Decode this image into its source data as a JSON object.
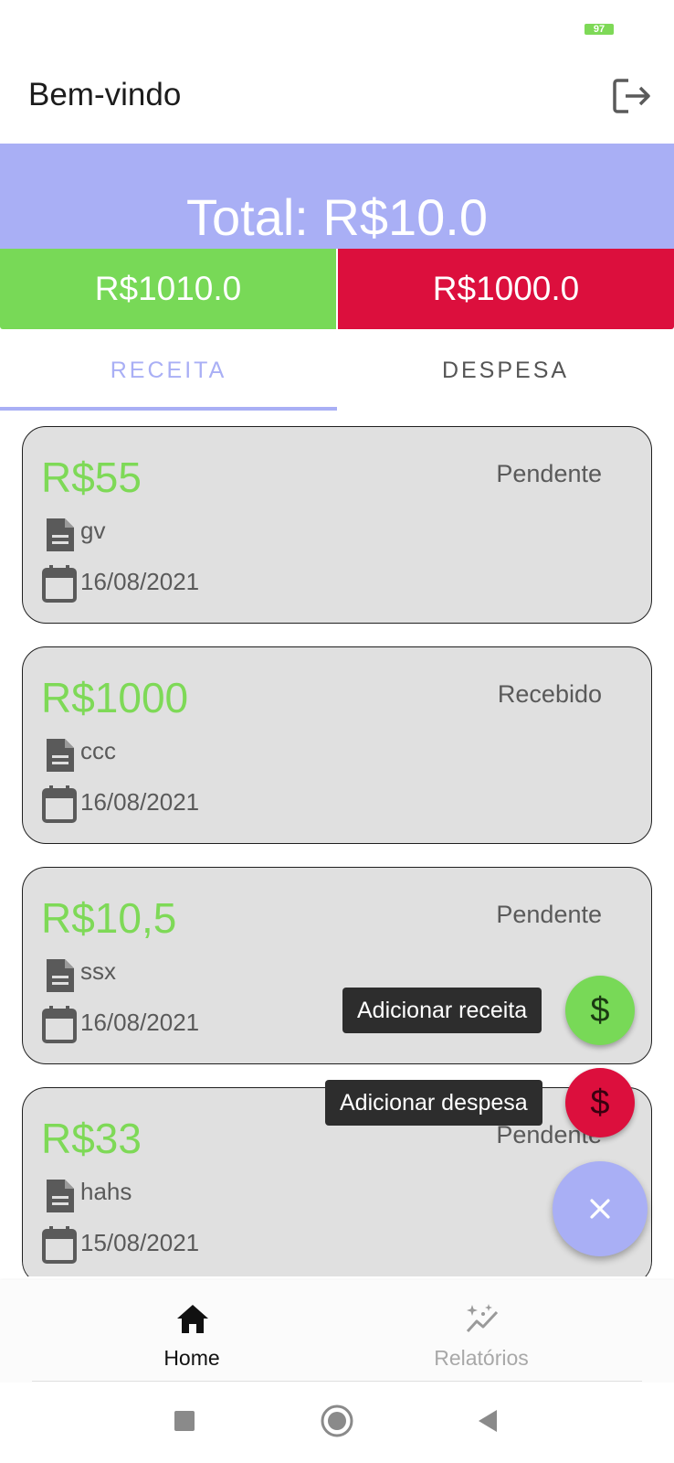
{
  "status_bar": {
    "battery": "97"
  },
  "app_bar": {
    "title": "Bem-vindo",
    "logout_icon": "logout-icon"
  },
  "summary": {
    "total": "Total: R$10.0",
    "income": "R$1010.0",
    "expense": "R$1000.0",
    "colors": {
      "total_bg": "#a9aff5",
      "income_bg": "#78d957",
      "expense_bg": "#dc0f3d"
    }
  },
  "tabs": [
    {
      "label": "RECEITA",
      "active": true
    },
    {
      "label": "DESPESA",
      "active": false
    }
  ],
  "entries": [
    {
      "amount": "R$55",
      "status": "Pendente",
      "description": "gv",
      "date": "16/08/2021"
    },
    {
      "amount": "R$1000",
      "status": "Recebido",
      "description": "ccc",
      "date": "16/08/2021"
    },
    {
      "amount": "R$10,5",
      "status": "Pendente",
      "description": "ssx",
      "date": "16/08/2021"
    },
    {
      "amount": "R$33",
      "status": "Pendente",
      "description": "hahs",
      "date": "15/08/2021"
    }
  ],
  "fab_menu": {
    "add_income_label": "Adicionar receita",
    "add_expense_label": "Adicionar despesa",
    "dollar_symbol": "$",
    "close_icon": "close-icon"
  },
  "bottom_nav": [
    {
      "label": "Home",
      "icon": "home-icon",
      "active": true
    },
    {
      "label": "Relatórios",
      "icon": "insights-icon",
      "active": false
    }
  ],
  "system_nav": {
    "icons": [
      "recents-icon",
      "home-circle-icon",
      "back-icon"
    ]
  }
}
